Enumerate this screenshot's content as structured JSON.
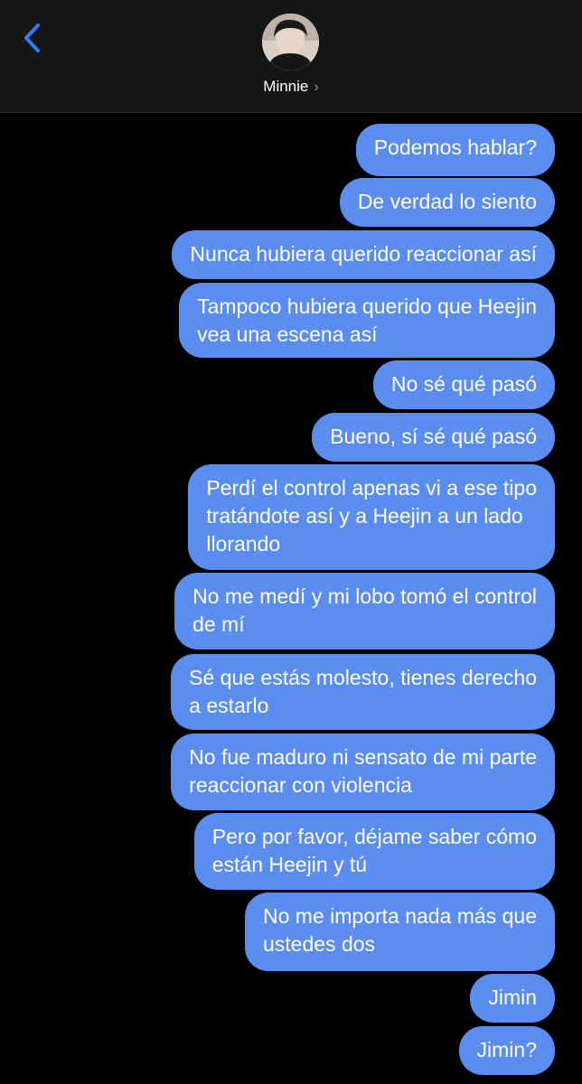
{
  "header": {
    "back_icon": "chevron-left-icon",
    "contact_name": "Minnie",
    "contact_chevron": "›",
    "accent_color": "#2f7cf6",
    "background": "#151515"
  },
  "thread": {
    "bubble_color": "#5b8cf0",
    "messages": [
      {
        "text": "Podemos hablar?"
      },
      {
        "text": "De verdad lo siento"
      },
      {
        "text": "Nunca hubiera querido reaccionar así"
      },
      {
        "text": "Tampoco hubiera querido que Heejin\nvea una escena así"
      },
      {
        "text": "No sé qué pasó"
      },
      {
        "text": "Bueno, sí sé qué pasó"
      },
      {
        "text": "Perdí el control apenas vi a ese tipo\ntratándote así y a Heejin a un lado\nllorando"
      },
      {
        "text": "No me medí y mi lobo tomó el control\nde mí"
      },
      {
        "text": "Sé que estás molesto, tienes derecho\na estarlo"
      },
      {
        "text": "No fue maduro ni sensato de mi parte\nreaccionar con violencia"
      },
      {
        "text": "Pero por favor, déjame saber cómo\nestán Heejin y tú"
      },
      {
        "text": "No me importa nada más que\nustedes dos"
      },
      {
        "text": "Jimin"
      },
      {
        "text": "Jimin?"
      }
    ]
  }
}
